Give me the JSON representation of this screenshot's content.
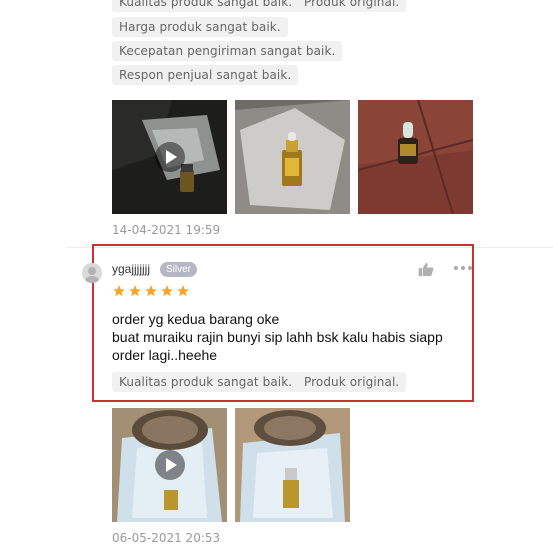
{
  "review_top": {
    "tags": [
      "Kualitas produk sangat baik.",
      "Produk original.",
      "Harga produk sangat baik.",
      "Kecepatan pengiriman sangat baik.",
      "Respon penjual sangat baik."
    ],
    "timestamp": "14-04-2021 19:59"
  },
  "review_main": {
    "username": "ygajjjjjjj",
    "badge": "Silver",
    "rating": 5,
    "text_lines": [
      "order yg kedua barang oke",
      "buat muraiku rajin bunyi sip lahh bsk kalu habis siapp",
      "order lagi..heehe"
    ],
    "tags": [
      "Kualitas produk sangat baik.",
      "Produk original."
    ],
    "timestamp": "06-05-2021 20:53"
  },
  "colors": {
    "highlight": "#c8322f",
    "star": "#f5a623",
    "badge": "#b5b8c4"
  },
  "icons": {
    "like": "thumbs-up-icon",
    "menu": "more-dots-icon",
    "play": "play-icon"
  }
}
